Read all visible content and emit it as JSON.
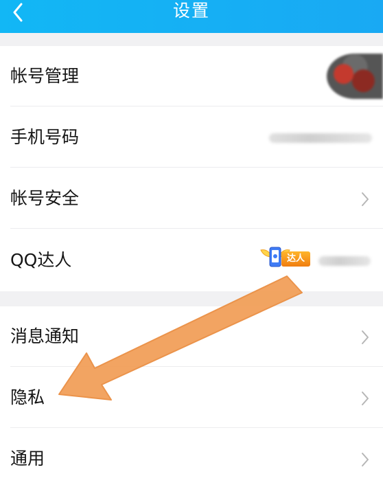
{
  "header": {
    "title": "设置",
    "back_icon": "chevron-left-icon"
  },
  "account_group": [
    {
      "label": "帐号管理"
    },
    {
      "label": "手机号码"
    },
    {
      "label": "帐号安全"
    },
    {
      "label": "QQ达人",
      "badge_text": "达人"
    }
  ],
  "general_group": [
    {
      "label": "消息通知"
    },
    {
      "label": "隐私"
    },
    {
      "label": "通用"
    }
  ],
  "colors": {
    "header": "#12b7f5",
    "arrow": "#f2a05a",
    "badge": "#f5961e"
  }
}
